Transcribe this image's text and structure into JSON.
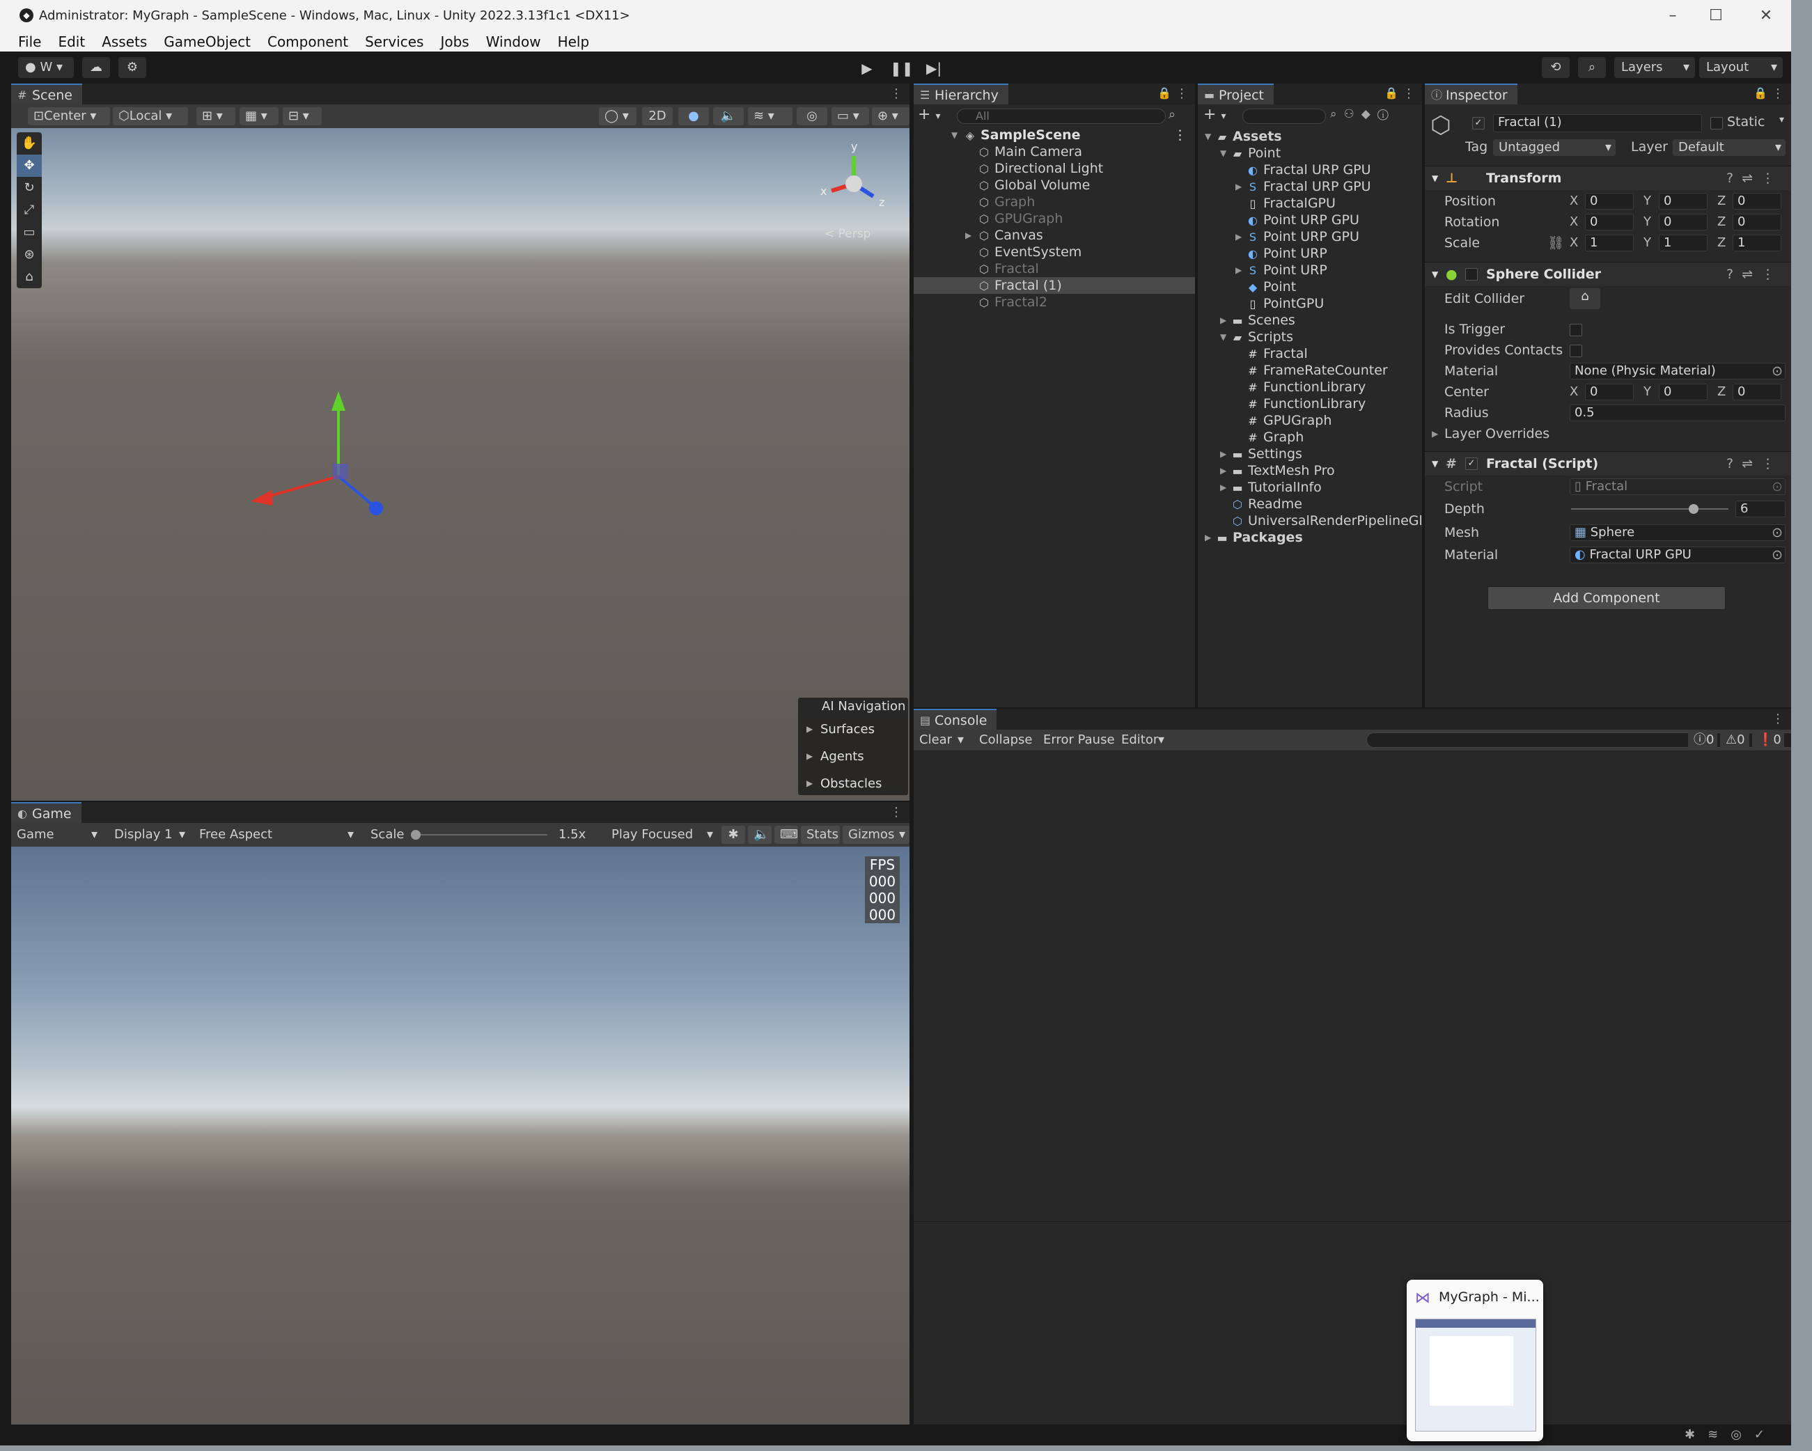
{
  "titlebar": {
    "title": "Administrator: MyGraph - SampleScene - Windows, Mac, Linux - Unity 2022.3.13f1c1 <DX11>"
  },
  "menu": [
    "File",
    "Edit",
    "Assets",
    "GameObject",
    "Component",
    "Services",
    "Jobs",
    "Window",
    "Help"
  ],
  "toolbar": {
    "account": "W",
    "layers": "Layers",
    "layout": "Layout"
  },
  "scene": {
    "tab": "Scene",
    "pivot": "Center",
    "space": "Local",
    "mode2d": "2D",
    "persp": "< Persp",
    "gizmo_axes": {
      "x": "x",
      "y": "y",
      "z": "z"
    },
    "ai_nav": {
      "title": "AI Navigation",
      "items": [
        "Surfaces",
        "Agents",
        "Obstacles"
      ]
    }
  },
  "game": {
    "tab": "Game",
    "mode": "Game",
    "display": "Display 1",
    "aspect": "Free Aspect",
    "scale_label": "Scale",
    "scale_value": "1.5x",
    "play_focus": "Play Focused",
    "stats": "Stats",
    "gizmos": "Gizmos",
    "fps": [
      "FPS",
      "000",
      "000",
      "000"
    ]
  },
  "hierarchy": {
    "tab": "Hierarchy",
    "search_placeholder": "All",
    "scene": "SampleScene",
    "items": [
      {
        "label": "Main Camera",
        "dim": false
      },
      {
        "label": "Directional Light",
        "dim": false
      },
      {
        "label": "Global Volume",
        "dim": false
      },
      {
        "label": "Graph",
        "dim": true
      },
      {
        "label": "GPUGraph",
        "dim": true
      },
      {
        "label": "Canvas",
        "dim": false,
        "collapsed": true
      },
      {
        "label": "EventSystem",
        "dim": false
      },
      {
        "label": "Fractal",
        "dim": true
      },
      {
        "label": "Fractal (1)",
        "dim": false,
        "selected": true
      },
      {
        "label": "Fractal2",
        "dim": true
      }
    ]
  },
  "project": {
    "tab": "Project",
    "rows": [
      {
        "label": "Assets",
        "indent": 0,
        "kind": "folder-open",
        "bold": true
      },
      {
        "label": "Point",
        "indent": 1,
        "kind": "folder-open"
      },
      {
        "label": "Fractal URP GPU",
        "indent": 2,
        "kind": "material"
      },
      {
        "label": "Fractal URP GPU",
        "indent": 2,
        "kind": "shader",
        "arrow": true
      },
      {
        "label": "FractalGPU",
        "indent": 2,
        "kind": "file"
      },
      {
        "label": "Point URP GPU",
        "indent": 2,
        "kind": "material"
      },
      {
        "label": "Point URP GPU",
        "indent": 2,
        "kind": "shader",
        "arrow": true
      },
      {
        "label": "Point URP",
        "indent": 2,
        "kind": "material"
      },
      {
        "label": "Point URP",
        "indent": 2,
        "kind": "shader",
        "arrow": true
      },
      {
        "label": "Point",
        "indent": 2,
        "kind": "prefab"
      },
      {
        "label": "PointGPU",
        "indent": 2,
        "kind": "file"
      },
      {
        "label": "Scenes",
        "indent": 1,
        "kind": "folder",
        "arrow": true
      },
      {
        "label": "Scripts",
        "indent": 1,
        "kind": "folder-open"
      },
      {
        "label": "Fractal",
        "indent": 2,
        "kind": "script"
      },
      {
        "label": "FrameRateCounter",
        "indent": 2,
        "kind": "script"
      },
      {
        "label": "FunctionLibrary",
        "indent": 2,
        "kind": "script"
      },
      {
        "label": "FunctionLibrary",
        "indent": 2,
        "kind": "script"
      },
      {
        "label": "GPUGraph",
        "indent": 2,
        "kind": "script"
      },
      {
        "label": "Graph",
        "indent": 2,
        "kind": "script"
      },
      {
        "label": "Settings",
        "indent": 1,
        "kind": "folder",
        "arrow": true
      },
      {
        "label": "TextMesh Pro",
        "indent": 1,
        "kind": "folder",
        "arrow": true
      },
      {
        "label": "TutorialInfo",
        "indent": 1,
        "kind": "folder",
        "arrow": true
      },
      {
        "label": "Readme",
        "indent": 1,
        "kind": "asset"
      },
      {
        "label": "UniversalRenderPipelineGlol",
        "indent": 1,
        "kind": "asset"
      },
      {
        "label": "Packages",
        "indent": 0,
        "kind": "folder",
        "arrow": true,
        "bold": true
      }
    ]
  },
  "inspector": {
    "tab": "Inspector",
    "object_name": "Fractal (1)",
    "static_label": "Static",
    "tag_label": "Tag",
    "tag_value": "Untagged",
    "layer_label": "Layer",
    "layer_value": "Default",
    "transform": {
      "title": "Transform",
      "position_label": "Position",
      "position": [
        "0",
        "0",
        "0"
      ],
      "rotation_label": "Rotation",
      "rotation": [
        "0",
        "0",
        "0"
      ],
      "scale_label": "Scale",
      "scale": [
        "1",
        "1",
        "1"
      ]
    },
    "sphere_collider": {
      "title": "Sphere Collider",
      "edit_collider": "Edit Collider",
      "is_trigger": "Is Trigger",
      "provides_contacts": "Provides Contacts",
      "material_label": "Material",
      "material": "None (Physic Material)",
      "center_label": "Center",
      "center": [
        "0",
        "0",
        "0"
      ],
      "radius_label": "Radius",
      "radius": "0.5",
      "layer_overrides": "Layer Overrides"
    },
    "fractal_script": {
      "title": "Fractal (Script)",
      "script_label": "Script",
      "script": "Fractal",
      "depth_label": "Depth",
      "depth": "6",
      "depth_fraction": 0.78,
      "mesh_label": "Mesh",
      "mesh": "Sphere",
      "material_label": "Material",
      "material": "Fractal URP GPU"
    },
    "add_component": "Add Component"
  },
  "console": {
    "tab": "Console",
    "clear": "Clear",
    "collapse": "Collapse",
    "error_pause": "Error Pause",
    "editor": "Editor",
    "counts": [
      "0",
      "0",
      "0"
    ]
  },
  "taskbar_thumb": {
    "title": "MyGraph - Mi..."
  }
}
